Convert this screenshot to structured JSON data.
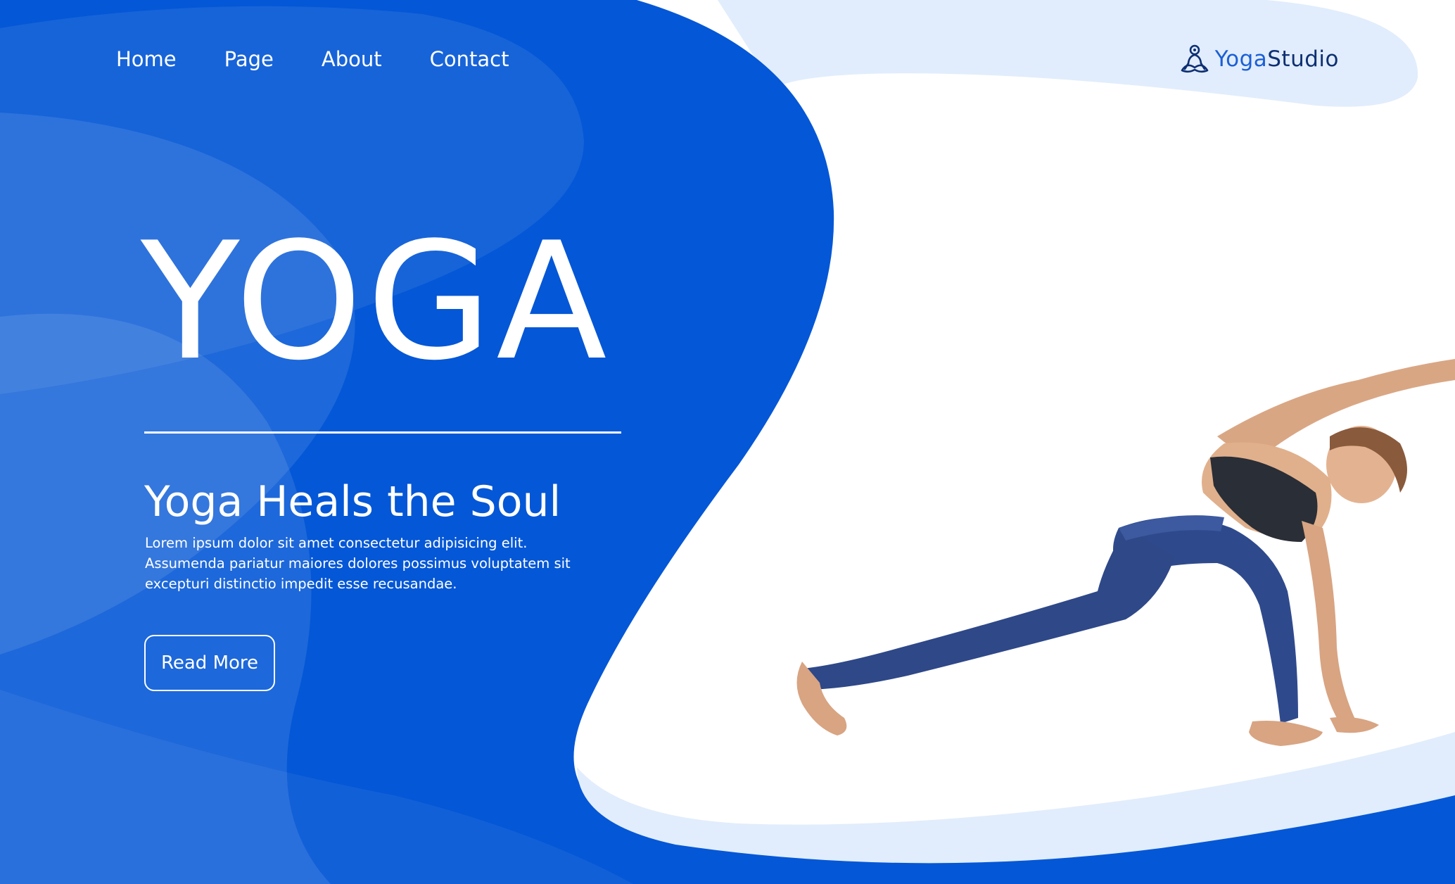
{
  "nav": {
    "items": [
      {
        "label": "Home"
      },
      {
        "label": "Page"
      },
      {
        "label": "About"
      },
      {
        "label": "Contact"
      }
    ]
  },
  "logo": {
    "text_part1": "Yoga",
    "text_part2": "Studio",
    "icon": "meditation-person-icon"
  },
  "hero": {
    "title": "YOGA",
    "subtitle": "Yoga Heals the Soul",
    "body": "Lorem ipsum dolor sit amet consectetur adipisicing elit. Assumenda pariatur maiores dolores possimus voluptatem sit excepturi distinctio impedit esse recusandae.",
    "button_label": "Read More"
  },
  "colors": {
    "primary_blue": "#0457d6",
    "light_blue_accent": "#e1edfc",
    "logo_blue": "#1b5fd6",
    "logo_navy": "#0e2f72",
    "white": "#ffffff"
  }
}
